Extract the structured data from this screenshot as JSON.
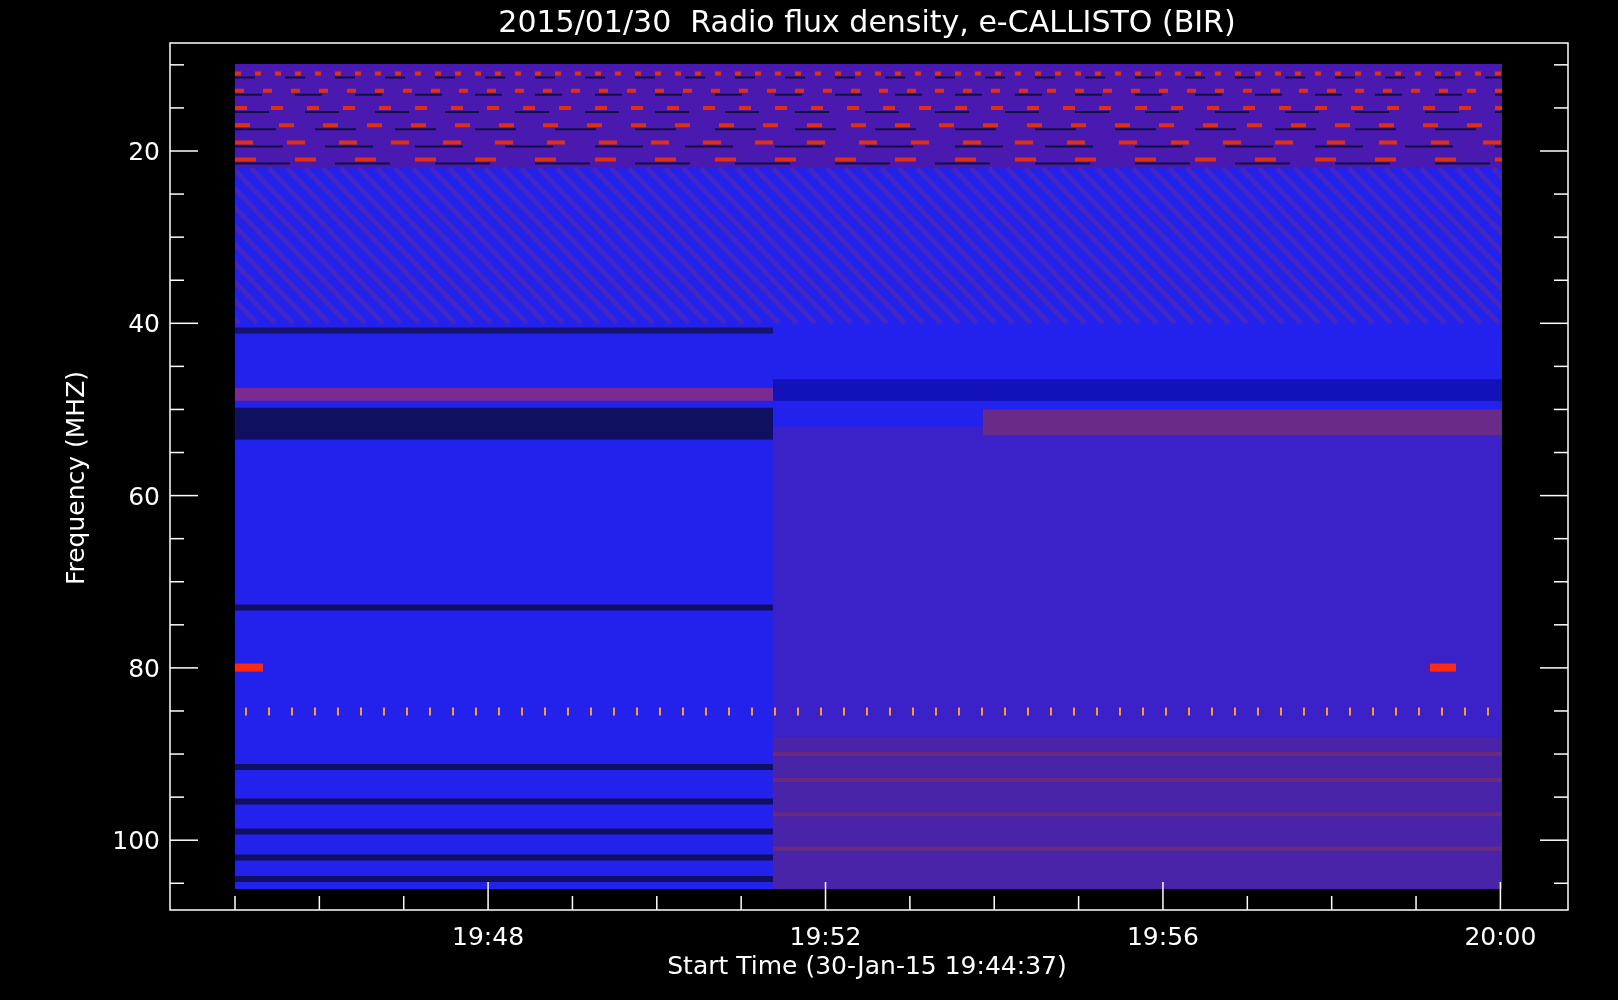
{
  "title": "2015/01/30  Radio flux density, e-CALLISTO (BIR)",
  "y_axis": {
    "label": "Frequency (MHZ)",
    "tick_labels": [
      "20",
      "40",
      "60",
      "80",
      "100"
    ]
  },
  "x_axis": {
    "label": "Start Time (30-Jan-15 19:44:37)",
    "tick_labels": [
      "19:48",
      "19:52",
      "19:56",
      "20:00"
    ]
  }
}
